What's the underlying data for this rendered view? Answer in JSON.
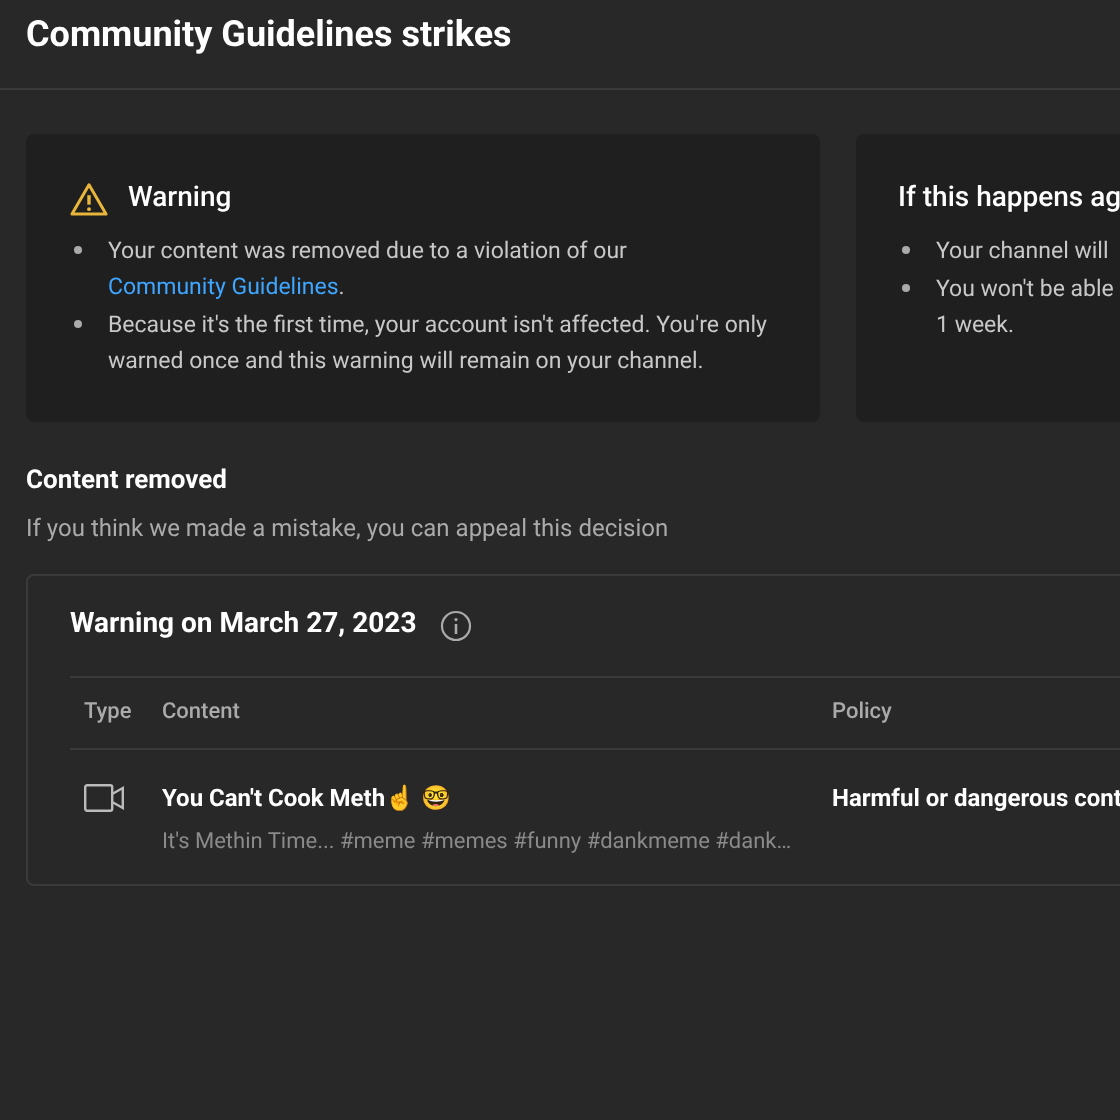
{
  "page": {
    "title": "Community Guidelines strikes"
  },
  "cards": [
    {
      "title": "Warning",
      "kind": "warning",
      "bullets": [
        "Your content was removed due to a violation of our ",
        "Because it's the first time, your account isn't affected. You're only warned once and this warning will remain on your channel."
      ],
      "link": {
        "text": "Community Guidelines",
        "after": "."
      }
    },
    {
      "title": "If this happens ag",
      "bullets": [
        "Your channel will",
        "You won't be able\n1 week."
      ]
    }
  ],
  "section": {
    "title": "Content removed",
    "subtitle": "If you think we made a mistake, you can appeal this decision"
  },
  "strike": {
    "title": "Warning on March 27, 2023",
    "columns": [
      "Type",
      "Content",
      "Policy"
    ],
    "rows": [
      {
        "kind": "video",
        "title": "You Can't Cook Meth☝️ 🤓",
        "description": "It's Methin Time... #meme #memes #funny #dankmeme #dank…",
        "policy": "Harmful or dangerous cont"
      }
    ]
  }
}
